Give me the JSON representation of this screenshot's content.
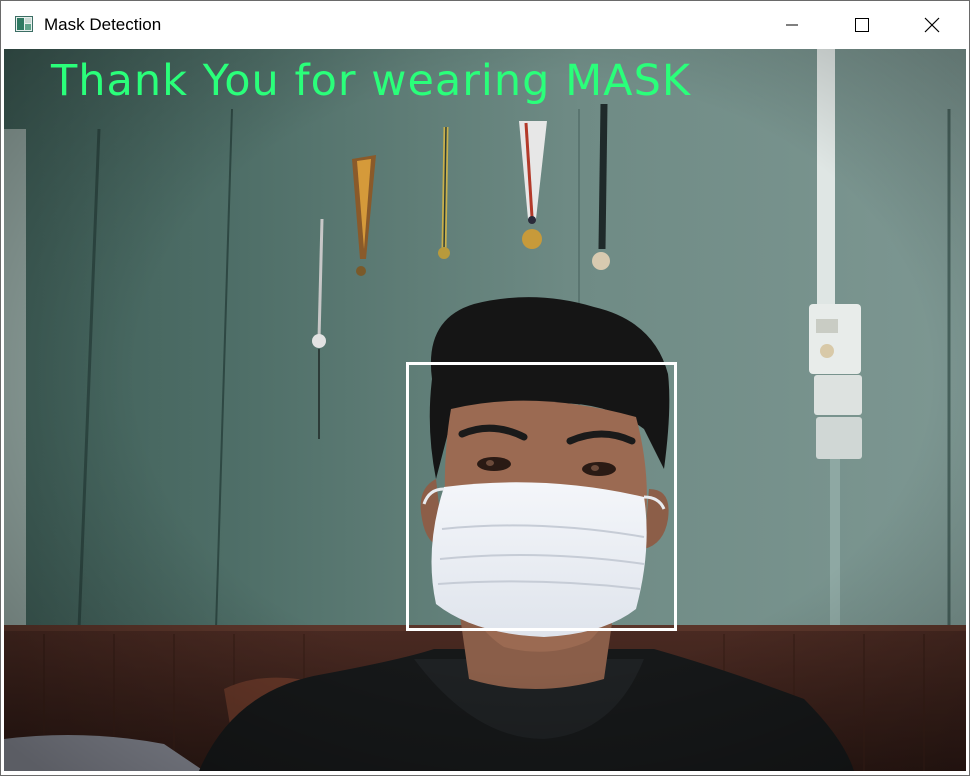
{
  "window": {
    "title": "Mask Detection",
    "controls": {
      "minimize": "minimize-icon",
      "maximize": "maximize-icon",
      "close": "close-icon"
    }
  },
  "video": {
    "status_text": "Thank You for wearing MASK",
    "status_color": "#2aff7a",
    "detection_box_color": "#ffffff"
  }
}
